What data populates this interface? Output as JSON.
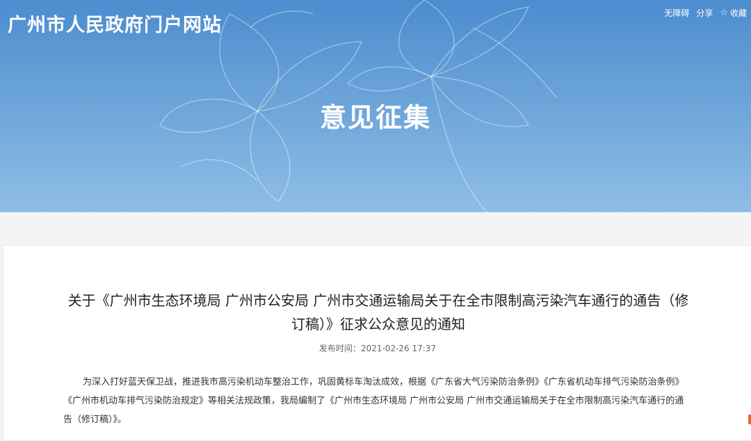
{
  "header": {
    "site_title": "广州市人民政府门户网站",
    "toolbar": {
      "accessibility_label": "无障碍",
      "share_label": "分享",
      "favorite_label": "收藏",
      "favorite_icon": "star-icon"
    },
    "banner_heading": "意见征集"
  },
  "article": {
    "title": "关于《广州市生态环境局 广州市公安局 广州市交通运输局关于在全市限制高污染汽车通行的通告（修订稿）》征求公众意见的通知",
    "publish_label": "发布时间：",
    "publish_time": "2021-02-26 17:37",
    "body": "为深入打好蓝天保卫战，推进我市高污染机动车整治工作，巩固黄标车淘汰成效，根据《广东省大气污染防治条例》《广东省机动车排气污染防治条例》《广州市机动车排气污染防治规定》等相关法规政策，我局编制了《广州市生态环境局 广州市公安局 广州市交通运输局关于在全市限制高污染汽车通行的通告（修订稿）》。"
  },
  "colors": {
    "banner_top": "#4c8ccf",
    "banner_bottom": "#8fbde6",
    "accent": "#e8662a"
  }
}
